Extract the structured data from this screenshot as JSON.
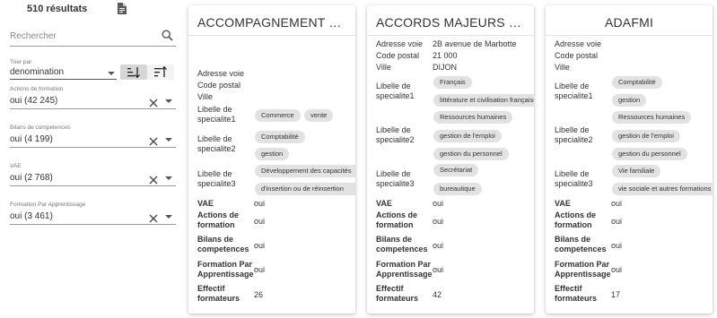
{
  "results": {
    "count": "510 résultats",
    "export_icon": "document-icon"
  },
  "search": {
    "placeholder": "Rechercher",
    "icon": "search-icon"
  },
  "sort": {
    "label": "Trier par",
    "value": "denomination",
    "asc_icon": "sort-ascending-icon",
    "desc_icon": "sort-descending-icon"
  },
  "filters": [
    {
      "label": "Actions de formation",
      "value": "oui (42 245)"
    },
    {
      "label": "Bilans de competences",
      "value": "oui (4 199)"
    },
    {
      "label": "VAE",
      "value": "oui (2 768)"
    },
    {
      "label": "Formation Par Apprentissage",
      "value": "oui (3 461)"
    }
  ],
  "cards": [
    {
      "title": "ACCOMPAGNEMENT ET F...",
      "labels": {
        "adresse_voie": "Adresse voie",
        "code_postal": "Code postal",
        "ville": "Ville",
        "spec1_a": "Libelle de",
        "spec1_b": "specialite1",
        "spec2_a": "Libelle de",
        "spec2_b": "specialite2",
        "spec3_a": "Libelle de",
        "spec3_b": "specialite3",
        "vae": "VAE",
        "actions_a": "Actions de",
        "actions_b": "formation",
        "bilans_a": "Bilans de",
        "bilans_b": "competences",
        "fpa_a": "Formation Par",
        "fpa_b": "Apprentissage",
        "effectif_a": "Effectif",
        "effectif_b": "formateurs"
      },
      "values": {
        "adresse_voie": "",
        "code_postal": "",
        "ville": "",
        "vae": "oui",
        "actions": "oui",
        "bilans": "oui",
        "fpa": "oui",
        "effectif": "26"
      },
      "chips": {
        "spec1": [
          "Commerce",
          "vente"
        ],
        "spec2": [
          "Comptabilité",
          "gestion"
        ],
        "spec3": [
          "Développement des capacités",
          "d'insertion ou de réinsertion"
        ]
      }
    },
    {
      "title": "ACCORDS MAJEURS COAC...",
      "labels": {
        "adresse_voie": "Adresse voie",
        "code_postal": "Code postal",
        "ville": "Ville",
        "spec1_a": "Libelle de",
        "spec1_b": "specialite1",
        "spec2_a": "Libelle de",
        "spec2_b": "specialite2",
        "spec3_a": "Libelle de",
        "spec3_b": "specialite3",
        "vae": "VAE",
        "actions_a": "Actions de",
        "actions_b": "formation",
        "bilans_a": "Bilans de",
        "bilans_b": "competences",
        "fpa_a": "Formation Par",
        "fpa_b": "Apprentissage",
        "effectif_a": "Effectif",
        "effectif_b": "formateurs"
      },
      "values": {
        "adresse_voie": "2B avenue de Marbotte",
        "code_postal": "21 000",
        "ville": "DIJON",
        "vae": "oui",
        "actions": "oui",
        "bilans": "oui",
        "fpa": "oui",
        "effectif": "42"
      },
      "chips": {
        "spec1": [
          "Français",
          "littérature et civilisation françaises",
          "Ressources humaines"
        ],
        "spec2": [
          "gestion de l'emploi",
          "gestion du personnel"
        ],
        "spec3": [
          "Secrétariat",
          "bureautique"
        ]
      }
    },
    {
      "title": "ADAFMI",
      "labels": {
        "adresse_voie": "Adresse voie",
        "code_postal": "Code postal",
        "ville": "Ville",
        "spec1_a": "Libelle de",
        "spec1_b": "specialite1",
        "spec2_a": "Libelle de",
        "spec2_b": "specialite2",
        "spec3_a": "Libelle de",
        "spec3_b": "specialite3",
        "vae": "VAE",
        "actions_a": "Actions de",
        "actions_b": "formation",
        "bilans_a": "Bilans de",
        "bilans_b": "competences",
        "fpa_a": "Formation Par",
        "fpa_b": "Apprentissage",
        "effectif_a": "Effectif",
        "effectif_b": "formateurs"
      },
      "values": {
        "adresse_voie": "",
        "code_postal": "",
        "ville": "",
        "vae": "oui",
        "actions": "oui",
        "bilans": "oui",
        "fpa": "oui",
        "effectif": "17"
      },
      "chips": {
        "spec1": [
          "Comptabilité",
          "gestion",
          "Ressources humaines"
        ],
        "spec2": [
          "gestion de l'emploi",
          "gestion du personnel"
        ],
        "spec3": [
          "Vie familiale",
          "vie sociale et autres formations"
        ]
      }
    }
  ],
  "colors": {
    "chip_bg": "#e2e2e2",
    "card_bg": "#ffffff",
    "text": "#333333"
  }
}
